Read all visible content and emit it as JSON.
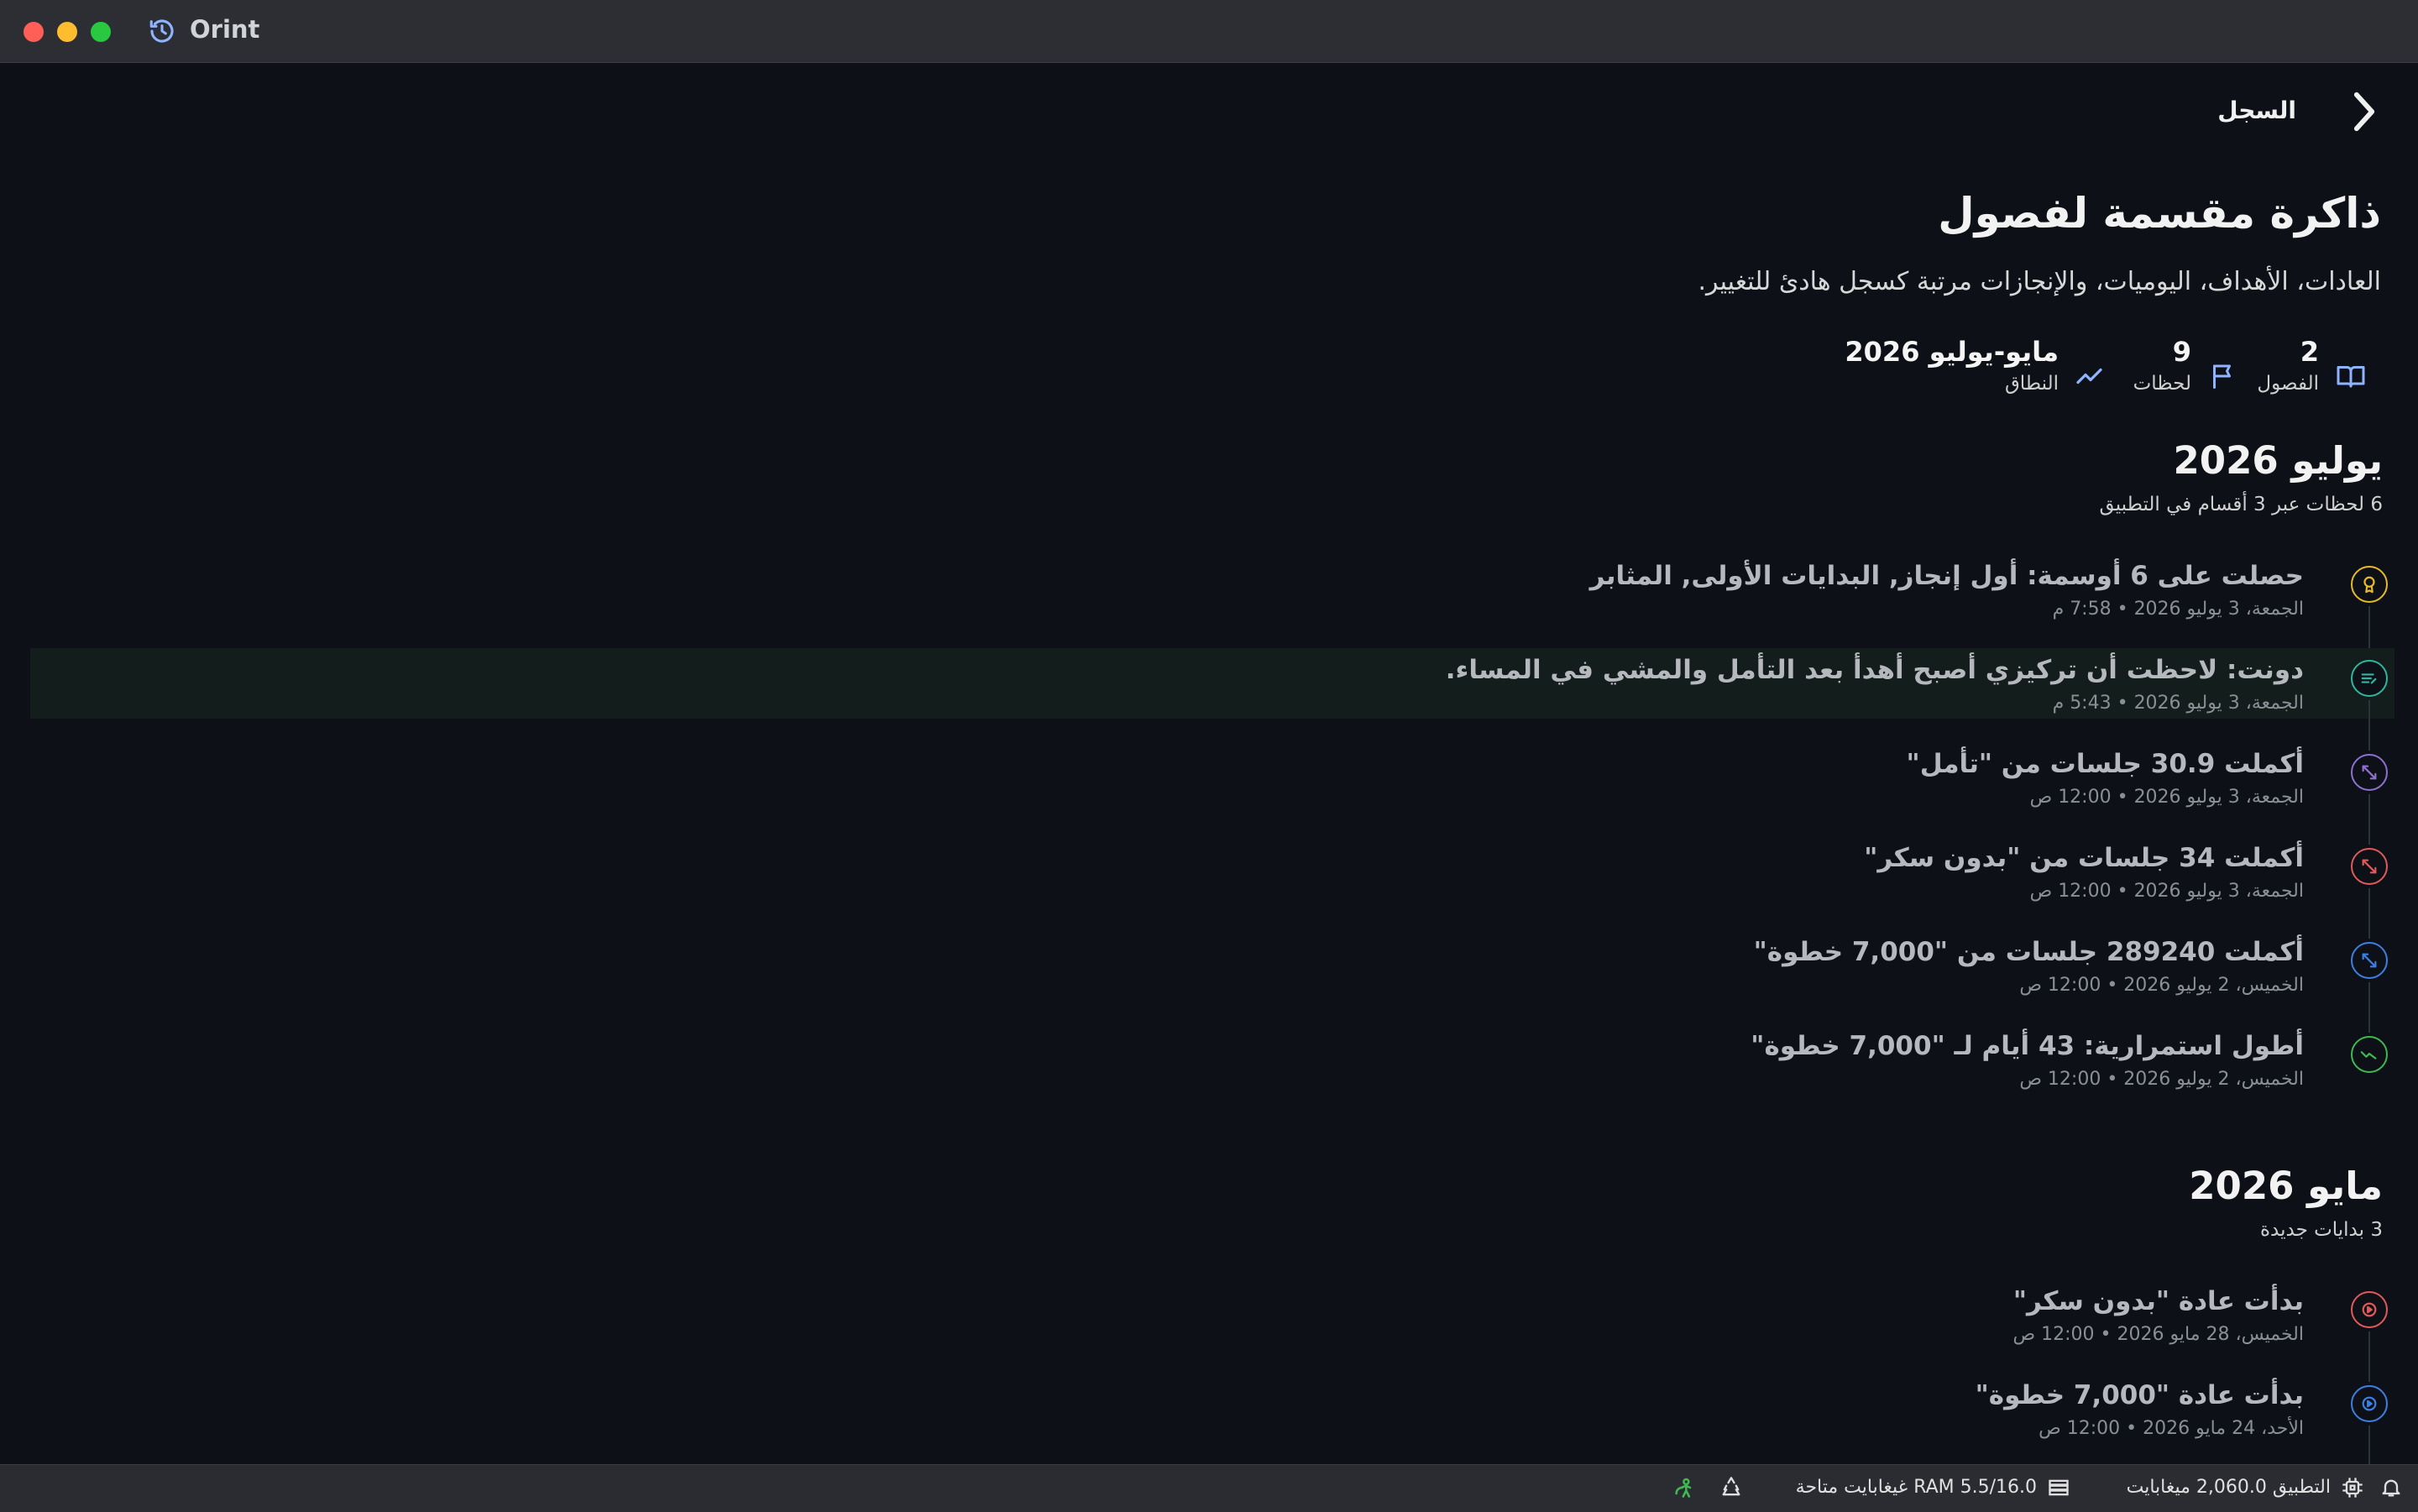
{
  "window": {
    "app_title": "Orint"
  },
  "nav": {
    "title": "السجل",
    "back_icon": "chevron-right-icon"
  },
  "header": {
    "title": "ذاكرة مقسمة لفصول",
    "subtitle": "العادات، الأهداف، اليوميات، والإنجازات مرتبة كسجل هادئ للتغيير."
  },
  "stats": {
    "chapters": {
      "value": "2",
      "label": "الفصول",
      "icon": "book-open-icon"
    },
    "moments": {
      "value": "9",
      "label": "لحظات",
      "icon": "flag-icon"
    },
    "range": {
      "value": "مايو-يوليو 2026",
      "label": "النطاق",
      "icon": "trend-line-icon"
    }
  },
  "sections": [
    {
      "title": "يوليو 2026",
      "subtitle": "6 لحظات عبر 3 أقسام في التطبيق",
      "events": [
        {
          "title": "حصلت على 6 أوسمة: أول إنجاز, البدايات الأولى, المثابر",
          "date": "الجمعة، 3 يوليو 2026 • 7:58 م",
          "icon": "medal-icon",
          "color": "#e8b928",
          "highlighted": false
        },
        {
          "title": "دونت: لاحظت أن تركيزي أصبح أهدأ بعد التأمل والمشي في المساء.",
          "date": "الجمعة، 3 يوليو 2026 • 5:43 م",
          "icon": "journal-lines-icon",
          "color": "#2fb5a0",
          "highlighted": true
        },
        {
          "title": "أكملت 30.9 جلسات من \"تأمل\"",
          "date": "الجمعة، 3 يوليو 2026 • 12:00 ص",
          "icon": "expand-arrows-icon",
          "color": "#8f6fd0",
          "highlighted": false
        },
        {
          "title": "أكملت 34 جلسات من \"بدون سكر\"",
          "date": "الجمعة، 3 يوليو 2026 • 12:00 ص",
          "icon": "expand-arrows-icon",
          "color": "#e05a5a",
          "highlighted": false
        },
        {
          "title": "أكملت 289240 جلسات من \"7,000 خطوة\"",
          "date": "الخميس، 2 يوليو 2026 • 12:00 ص",
          "icon": "expand-arrows-icon",
          "color": "#3d7fe0",
          "highlighted": false
        },
        {
          "title": "أطول استمرارية: 43 أيام لـ \"7,000 خطوة\"",
          "date": "الخميس، 2 يوليو 2026 • 12:00 ص",
          "icon": "trend-line-icon",
          "color": "#3fb950",
          "highlighted": false
        }
      ]
    },
    {
      "title": "مايو 2026",
      "subtitle": "3 بدايات جديدة",
      "events": [
        {
          "title": "بدأت عادة \"بدون سكر\"",
          "date": "الخميس، 28 مايو 2026 • 12:00 ص",
          "icon": "play-circle-icon",
          "color": "#e05a5a",
          "highlighted": false
        },
        {
          "title": "بدأت عادة \"7,000 خطوة\"",
          "date": "الأحد، 24 مايو 2026 • 12:00 ص",
          "icon": "play-circle-icon",
          "color": "#3d7fe0",
          "highlighted": false
        }
      ]
    }
  ],
  "statusbar": {
    "app_memory": "التطبيق 2,060.0 ميغابايت",
    "ram": "RAM 5.5/16.0 غيغابايت متاحة",
    "icons": [
      "bell-icon",
      "cpu-icon",
      "memory-icon",
      "recycle-icon",
      "leaf-person-icon"
    ]
  }
}
